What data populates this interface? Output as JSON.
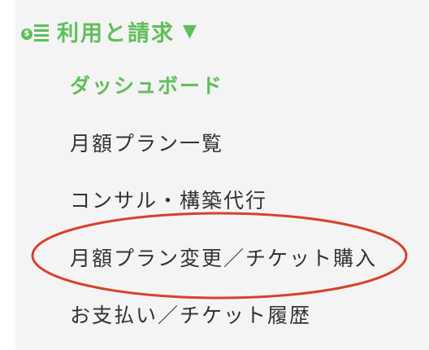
{
  "section": {
    "title": "利用と請求",
    "caret": "▼",
    "icon": "billing-list-icon",
    "accent_color": "#5fbf5b"
  },
  "menu": {
    "items": [
      {
        "label": "ダッシュボード",
        "active": true
      },
      {
        "label": "月額プラン一覧",
        "active": false
      },
      {
        "label": "コンサル・構築代行",
        "active": false
      },
      {
        "label": "月額プラン変更／チケット購入",
        "active": false
      },
      {
        "label": "お支払い／チケット履歴",
        "active": false
      }
    ]
  },
  "annotation": {
    "highlight_color": "#d9402b"
  }
}
